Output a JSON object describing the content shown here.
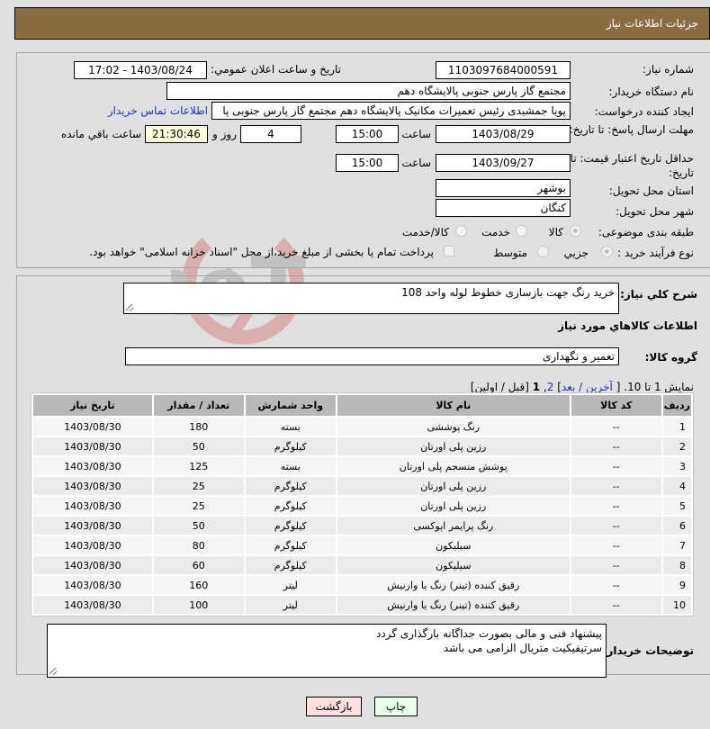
{
  "header": {
    "title": "جزئیات اطلاعات نیاز"
  },
  "form": {
    "need_number": {
      "label": "شماره نیاز:",
      "value": "1103097684000591"
    },
    "announce": {
      "label": "تاريخ و ساعت اعلان عمومي:",
      "value": "1403/08/24 - 17:02"
    },
    "buyer_org": {
      "label": "نام دستگاه خريدار:",
      "value": "مجتمع گاز پارس جنوبی  پالايشگاه دهم"
    },
    "creator": {
      "label": "ايجاد کننده درخواست:",
      "value": "پویا جمشیدی رئیس تعمیرات مکانیک پالايشگاه دهم  مجتمع گاز پارس جنوبی  پا",
      "contact_link": "اطلاعات تماس خريدار"
    },
    "reply_deadline": {
      "label": "مهلت ارسال پاسخ: تا تاريخ:",
      "date": "1403/08/29",
      "time_label": "ساعت",
      "time": "15:00",
      "days": "4",
      "days_label": "روز و",
      "remaining": "21:30:46",
      "remaining_label": "ساعت باقي مانده"
    },
    "price_validity": {
      "label": "حداقل تاريخ اعتبار قيمت: تا تاريخ:",
      "date": "1403/09/27",
      "time_label": "ساعت",
      "time": "15:00"
    },
    "province": {
      "label": "استان محل تحويل:",
      "value": "بوشهر"
    },
    "city": {
      "label": "شهر محل تحويل:",
      "value": "کنگان"
    },
    "category": {
      "label": "طبقه بندی موضوعی:",
      "options": [
        {
          "label": "کالا",
          "checked": true
        },
        {
          "label": "خدمت",
          "checked": false
        },
        {
          "label": "کالا/خدمت",
          "checked": false
        }
      ]
    },
    "purchase_type": {
      "label": "نوع فرآيند خريد :",
      "options": [
        {
          "label": "جزيي",
          "checked": true
        },
        {
          "label": "متوسط",
          "checked": false
        }
      ],
      "treasury_note": "پرداخت تمام يا بخشی از مبلغ خريد،از محل \"اسناد خزانه اسلامی\" خواهد بود."
    }
  },
  "details": {
    "description_label": "شرح کلي نياز:",
    "description": "خرید رنگ جهت بازسازی خطوط لوله واحد 108",
    "goods_info_title": "اطلاعات کالاهاي مورد نياز",
    "goods_group_label": "گروه کالا:",
    "goods_group": "تعمیر و نگهداری",
    "pagination": {
      "showing": "نمایش 1 تا 10.",
      "open_bracket": "[",
      "last": "آخرين",
      "sep": "/",
      "next": "بعد",
      "close_bracket": "]",
      "page2": "2",
      "comma": ",",
      "page1": "1",
      "prev_first": "[قبل / اولين]"
    },
    "table": {
      "headers": [
        "رديف",
        "کد کالا",
        "نام کالا",
        "واحد شمارش",
        "تعداد / مقدار",
        "تاريخ نياز"
      ],
      "rows": [
        {
          "idx": "1",
          "code": "--",
          "name": "رنگ پوششی",
          "unit": "بسته",
          "qty": "180",
          "date": "1403/08/30"
        },
        {
          "idx": "2",
          "code": "--",
          "name": "رزین پلی اورتان",
          "unit": "کیلوگرم",
          "qty": "50",
          "date": "1403/08/30"
        },
        {
          "idx": "3",
          "code": "--",
          "name": "پوشش منسجم پلی اورتان",
          "unit": "بسته",
          "qty": "125",
          "date": "1403/08/30"
        },
        {
          "idx": "4",
          "code": "--",
          "name": "رزین پلی اورتان",
          "unit": "کیلوگرم",
          "qty": "25",
          "date": "1403/08/30"
        },
        {
          "idx": "5",
          "code": "--",
          "name": "رزین پلی اورتان",
          "unit": "کیلوگرم",
          "qty": "25",
          "date": "1403/08/30"
        },
        {
          "idx": "6",
          "code": "--",
          "name": "رنگ پرایمر اپوکسی",
          "unit": "کیلوگرم",
          "qty": "50",
          "date": "1403/08/30"
        },
        {
          "idx": "7",
          "code": "--",
          "name": "سیلیکون",
          "unit": "کیلوگرم",
          "qty": "80",
          "date": "1403/08/30"
        },
        {
          "idx": "8",
          "code": "--",
          "name": "سیلیکون",
          "unit": "کیلوگرم",
          "qty": "60",
          "date": "1403/08/30"
        },
        {
          "idx": "9",
          "code": "--",
          "name": "رقیق کننده (تینر) رنگ یا وارنیش",
          "unit": "لیتر",
          "qty": "160",
          "date": "1403/08/30"
        },
        {
          "idx": "10",
          "code": "--",
          "name": "رقیق کننده (تینر) رنگ یا وارنیش",
          "unit": "لیتر",
          "qty": "100",
          "date": "1403/08/30"
        }
      ]
    },
    "buyer_notes_label": "توضيحات خريدار:",
    "buyer_notes_line1": "پیشنهاد فنی و مالی بصورت جداگانه بارگذاری گردد",
    "buyer_notes_line2": "سرتیفیکیت متریال الزامی می باشد"
  },
  "buttons": {
    "print": "چاپ",
    "back": "بازگشت"
  },
  "colors": {
    "header_bg": "#8b6d42",
    "print_bg": "#eaffea",
    "back_bg": "#ffe0e0",
    "link": "#1a33cc"
  }
}
